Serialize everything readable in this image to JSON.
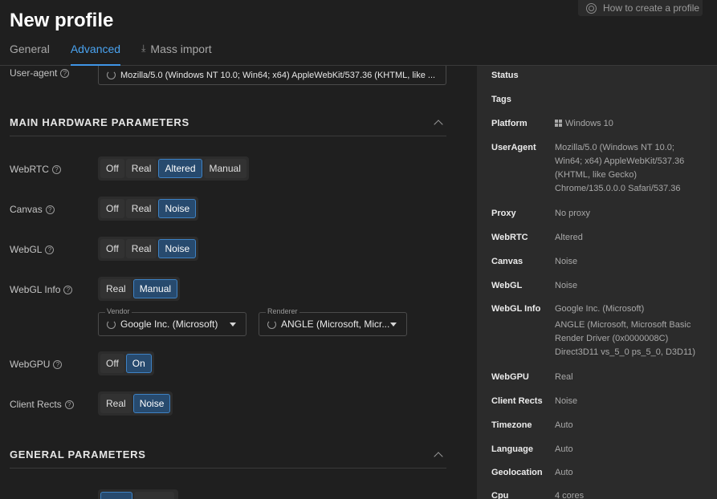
{
  "header": {
    "title": "New profile",
    "howto_label": "How to create a profile",
    "tabs": [
      {
        "label": "General"
      },
      {
        "label": "Advanced"
      },
      {
        "label": "Mass import"
      }
    ]
  },
  "user_agent": {
    "label": "User-agent",
    "value": "Mozilla/5.0 (Windows NT 10.0; Win64; x64) AppleWebKit/537.36 (KHTML, like ..."
  },
  "main_hardware": {
    "title": "MAIN HARDWARE PARAMETERS",
    "webrtc": {
      "label": "WebRTC",
      "options": [
        "Off",
        "Real",
        "Altered",
        "Manual"
      ],
      "selected": "Altered"
    },
    "canvas": {
      "label": "Canvas",
      "options": [
        "Off",
        "Real",
        "Noise"
      ],
      "selected": "Noise"
    },
    "webgl": {
      "label": "WebGL",
      "options": [
        "Off",
        "Real",
        "Noise"
      ],
      "selected": "Noise"
    },
    "webgl_info": {
      "label": "WebGL Info",
      "options": [
        "Real",
        "Manual"
      ],
      "selected": "Manual",
      "vendor_label": "Vendor",
      "vendor_value": "Google Inc. (Microsoft)",
      "renderer_label": "Renderer",
      "renderer_value": "ANGLE (Microsoft, Micr..."
    },
    "webgpu": {
      "label": "WebGPU",
      "options": [
        "Off",
        "On"
      ],
      "selected": "On"
    },
    "client_rects": {
      "label": "Client Rects",
      "options": [
        "Real",
        "Noise"
      ],
      "selected": "Noise"
    }
  },
  "general_params": {
    "title": "GENERAL PARAMETERS"
  },
  "summary": {
    "status": {
      "key": "Status",
      "value": ""
    },
    "tags": {
      "key": "Tags",
      "value": ""
    },
    "platform": {
      "key": "Platform",
      "value": "Windows 10"
    },
    "useragent": {
      "key": "UserAgent",
      "value": "Mozilla/5.0 (Windows NT 10.0; Win64; x64) AppleWebKit/537.36 (KHTML, like Gecko) Chrome/135.0.0.0 Safari/537.36"
    },
    "proxy": {
      "key": "Proxy",
      "value": "No proxy"
    },
    "webrtc": {
      "key": "WebRTC",
      "value": "Altered"
    },
    "canvas": {
      "key": "Canvas",
      "value": "Noise"
    },
    "webgl": {
      "key": "WebGL",
      "value": "Noise"
    },
    "webgl_info": {
      "key": "WebGL Info",
      "value": "Google Inc. (Microsoft)",
      "value2": "ANGLE (Microsoft, Microsoft Basic Render Driver (0x0000008C) Direct3D11 vs_5_0 ps_5_0, D3D11)"
    },
    "webgpu": {
      "key": "WebGPU",
      "value": "Real"
    },
    "client_rects": {
      "key": "Client Rects",
      "value": "Noise"
    },
    "timezone": {
      "key": "Timezone",
      "value": "Auto"
    },
    "language": {
      "key": "Language",
      "value": "Auto"
    },
    "geolocation": {
      "key": "Geolocation",
      "value": "Auto"
    },
    "cpu": {
      "key": "Cpu",
      "value": "4 cores"
    }
  },
  "colors": {
    "accent": "#3f95e6",
    "selected_bg": "#274a6e",
    "background": "#1f1f1f",
    "panel": "#2b2b2b"
  },
  "icons": [
    "help-icon",
    "refresh-icon",
    "download-icon",
    "chevron-up-icon",
    "windows-icon",
    "caret-down-icon"
  ]
}
